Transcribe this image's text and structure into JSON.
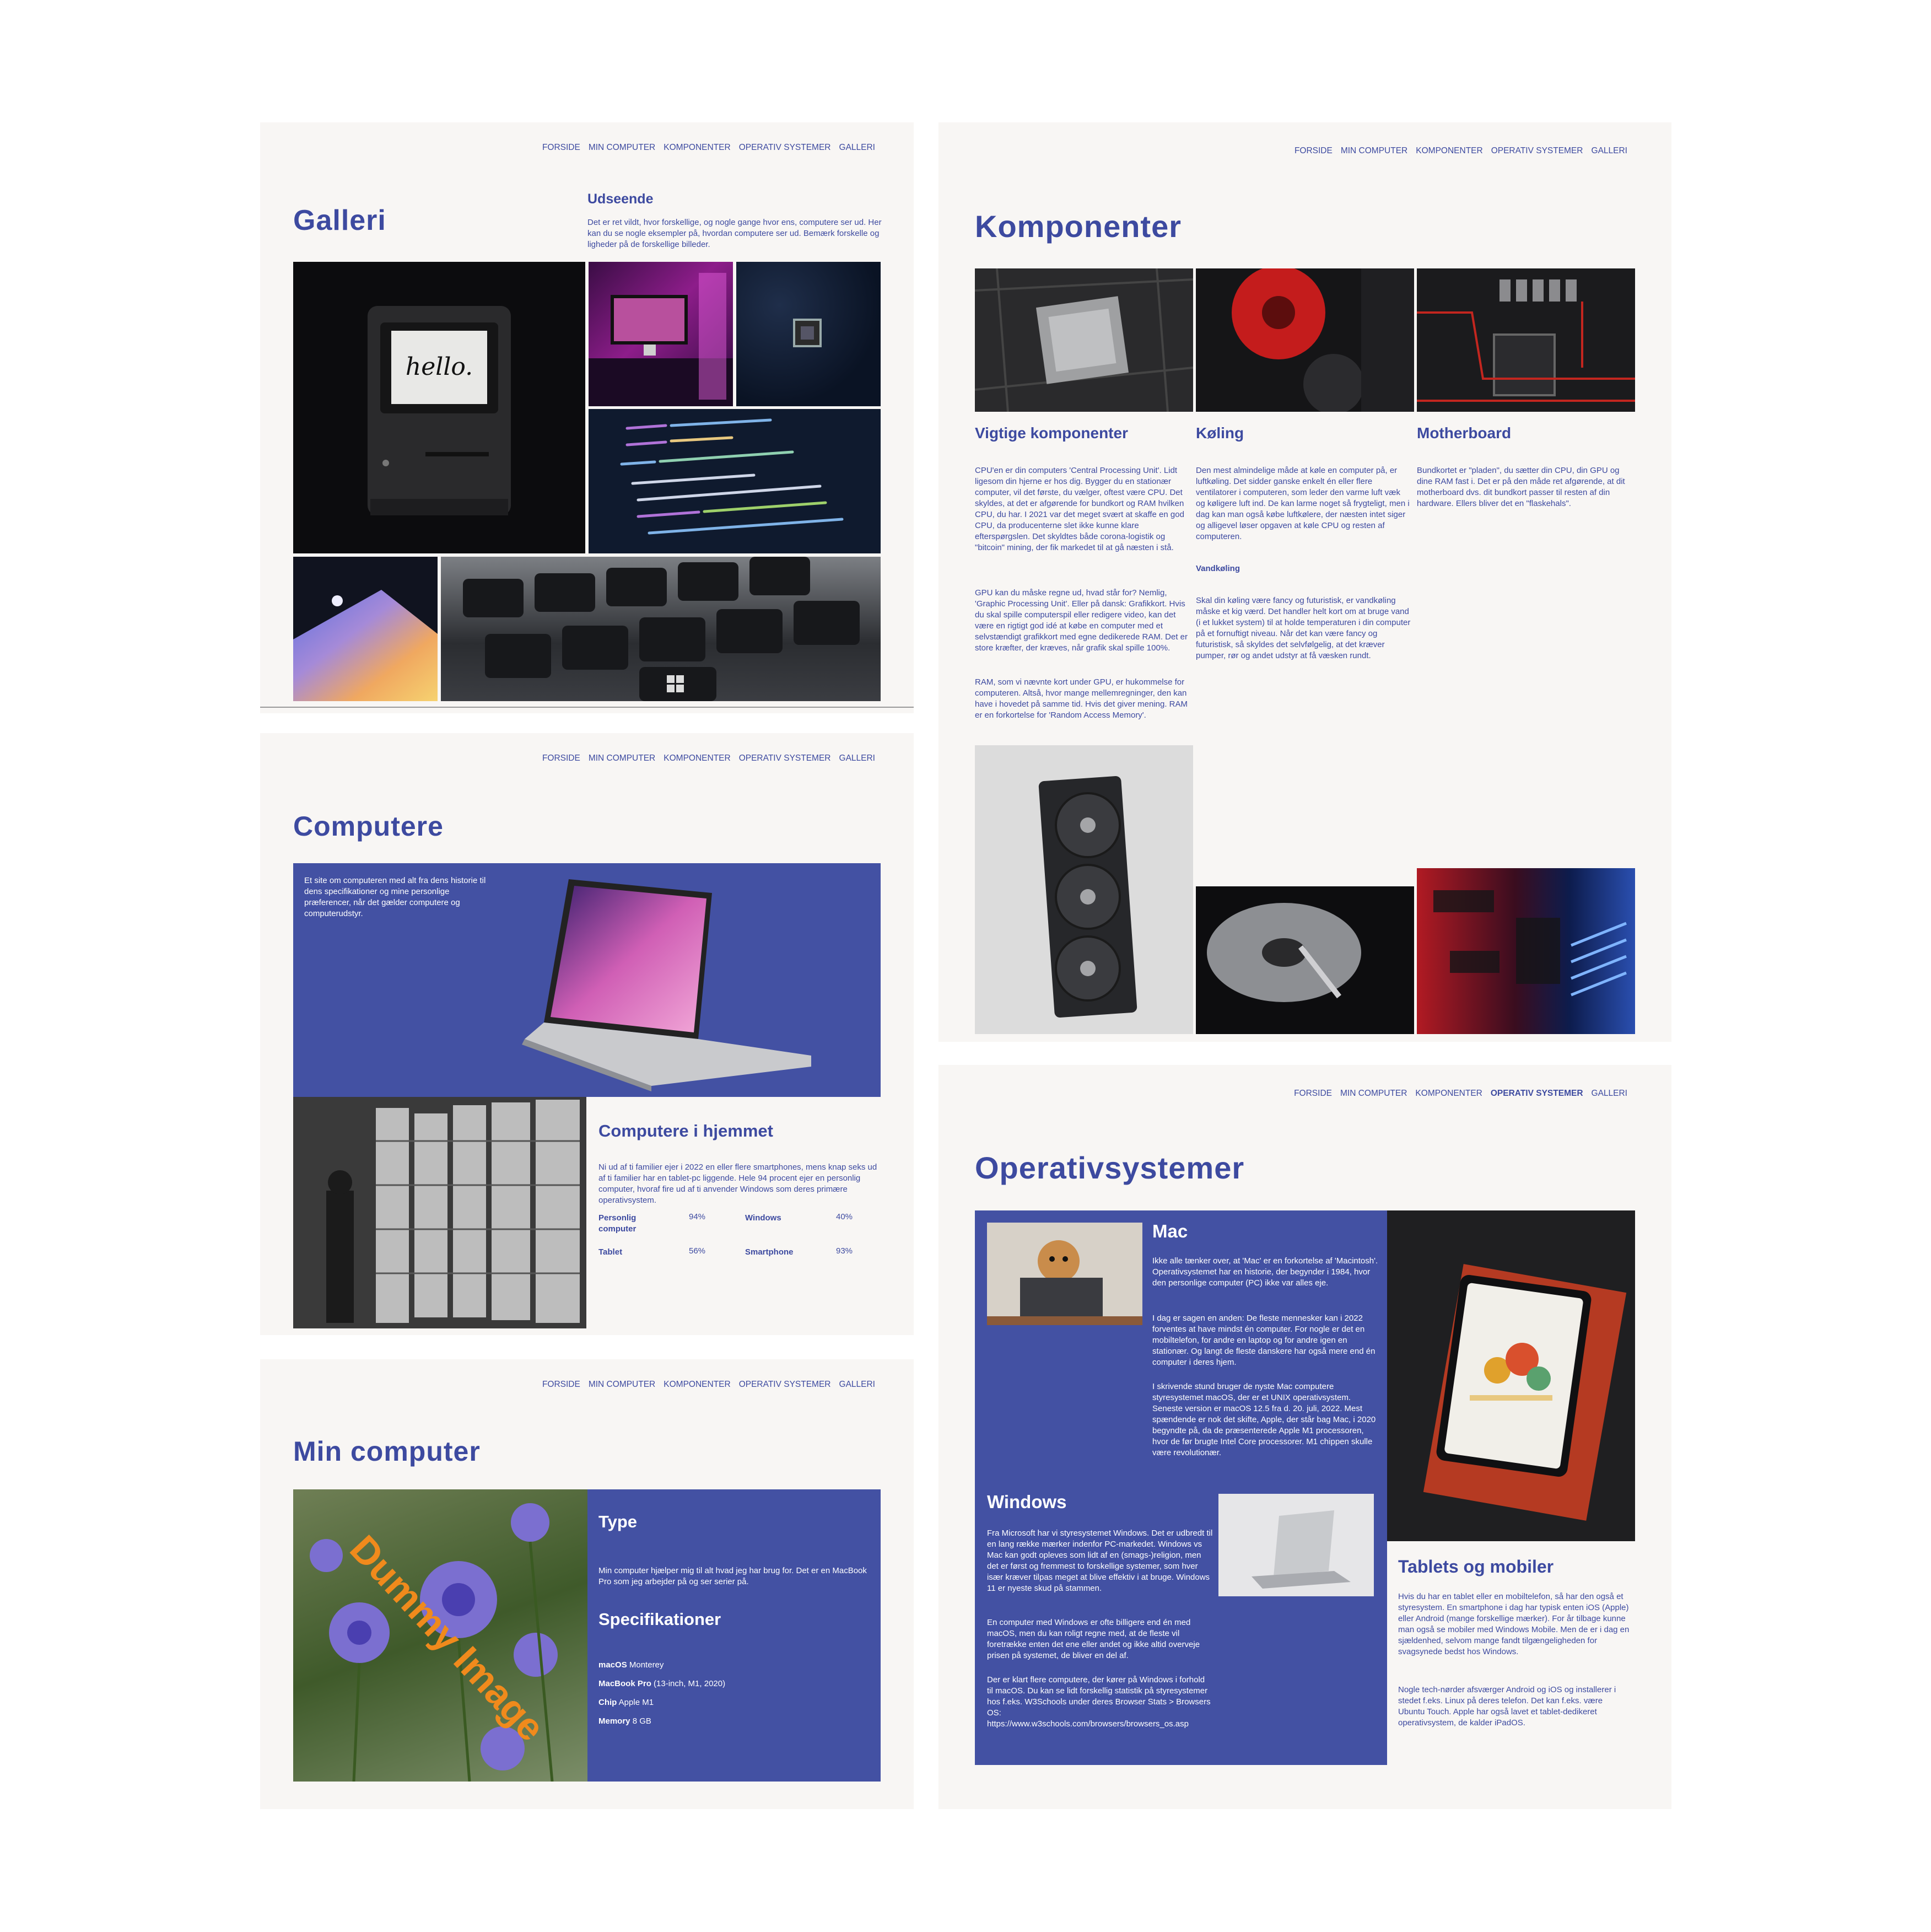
{
  "nav": [
    "FORSIDE",
    "MIN COMPUTER",
    "KOMPONENTER",
    "OPERATIV SYSTEMER",
    "GALLERI"
  ],
  "galleri": {
    "title": "Galleri",
    "heading": "Udseende",
    "text": "Det er ret vildt, hvor forskellige, og nogle gange hvor ens, computere ser ud. Her kan du se nogle eksempler på, hvordan computere ser ud. Bemærk forskelle og ligheder på de forskellige billeder.",
    "mac_screen_text": "hello."
  },
  "computere": {
    "title": "Computere",
    "hero_text": "Et site om computeren med alt fra dens historie til dens specifikationer og mine personlige præferencer, når det gælder computere og computerudstyr.",
    "heading": "Computere i hjemmet",
    "text": "Ni ud af ti familier ejer i 2022 en eller flere smartphones, mens knap seks ud af ti familier har en tablet-pc liggende. Hele 94 procent ejer en personlig computer, hvoraf fire ud af ti anvender Windows som deres primære operativsystem.",
    "stats": [
      {
        "label": "Personlig computer",
        "value": "94%"
      },
      {
        "label": "Windows",
        "value": "40%"
      },
      {
        "label": "Tablet",
        "value": "56%"
      },
      {
        "label": "Smartphone",
        "value": "93%"
      }
    ]
  },
  "min_computer": {
    "title": "Min computer",
    "watermark": "Dummy Image",
    "type_heading": "Type",
    "type_text": "Min computer hjælper mig til alt hvad jeg har brug for. Det er en MacBook Pro som jeg arbejder på og ser serier på.",
    "spec_heading": "Specifikationer",
    "specs": [
      {
        "label": "macOS",
        "value": "Monterey"
      },
      {
        "label": "MacBook Pro",
        "value": "(13-inch, M1, 2020)"
      },
      {
        "label": "Chip",
        "value": "Apple M1"
      },
      {
        "label": "Memory",
        "value": "8 GB"
      }
    ]
  },
  "komponenter": {
    "title": "Komponenter",
    "col1_heading": "Vigtige komponenter",
    "col1_p1": "CPU'en er din computers 'Central Processing Unit'. Lidt ligesom din hjerne er hos dig. Bygger du en stationær computer, vil det første, du vælger, oftest være CPU. Det skyldes, at det er afgørende for bundkort og RAM hvilken CPU, du har. I 2021 var det meget svært at skaffe en god CPU, da producenterne slet ikke kunne klare efterspørgslen. Det skyldtes både corona-logistik og \"bitcoin\" mining, der fik markedet til at gå næsten i stå.",
    "col1_p2": "GPU kan du måske regne ud, hvad står for? Nemlig, 'Graphic Processing Unit'. Eller på dansk: Grafikkort. Hvis du skal spille computerspil eller redigere video, kan det være en rigtigt god idé at købe en computer med et selvstændigt grafikkort med egne dedikerede RAM. Det er store kræfter, der kræves, når grafik skal spille 100%.",
    "col1_p3": "RAM, som vi nævnte kort under GPU, er hukommelse for computeren. Altså, hvor mange mellemregninger, den kan have i hovedet på samme tid. Hvis det giver mening. RAM er en forkortelse for 'Random Access Memory'.",
    "col2_heading": "Køling",
    "col2_p1": "Den mest almindelige måde at køle en computer på, er luftkøling. Det sidder ganske enkelt én eller flere ventilatorer i computeren, som leder den varme luft væk og køligere luft ind. De kan larme noget så frygteligt, men i dag kan man også købe luftkølere, der næsten intet siger og alligevel løser opgaven at køle CPU og resten af computeren.",
    "col2_sub": "Vandkøling",
    "col2_p2": "Skal din køling være fancy og futuristisk, er vandkøling måske et kig værd. Det handler helt kort om at bruge vand (i et lukket system) til at holde temperaturen i din computer på et fornuftigt niveau. Når det kan være fancy og futuristisk, så skyldes det selvfølgelig, at det kræver pumper, rør og andet udstyr at få væsken rundt.",
    "col3_heading": "Motherboard",
    "col3_p1": "Bundkortet er \"pladen\", du sætter din CPU, din GPU og dine RAM fast i. Det er på den måde ret afgørende, at dit motherboard dvs. dit bundkort passer til resten af din hardware. Ellers bliver det en \"flaskehals\"."
  },
  "os": {
    "title": "Operativsystemer",
    "mac_heading": "Mac",
    "mac_p1": "Ikke alle tænker over, at 'Mac' er en forkortelse af 'Macintosh'. Operativsystemet har en historie, der begynder i 1984, hvor den personlige computer (PC) ikke var alles eje.",
    "mac_p2": "I dag er sagen en anden: De fleste mennesker kan i 2022 forventes at have mindst én computer. For nogle er det en mobiltelefon, for andre en laptop og for andre igen en stationær. Og langt de fleste danskere har også mere end én computer i deres hjem.",
    "mac_p3": "I skrivende stund bruger de nyste Mac computere styresystemet macOS, der er et UNIX operativsystem. Seneste version er macOS 12.5 fra d. 20. juli, 2022. Mest spændende er nok det skifte, Apple, der står bag Mac, i 2020 begyndte på, da de præsenterede Apple M1 processoren, hvor de før brugte Intel Core processorer. M1 chippen skulle være revolutionær.",
    "win_heading": "Windows",
    "win_p1": "Fra Microsoft har vi styresystemet Windows. Det er udbredt til en lang række mærker indenfor PC-markedet. Windows vs Mac kan godt opleves som lidt af en (smags-)religion, men det er først og fremmest to forskellige systemer, som hver især kræver tilpas meget at blive effektiv i at bruge. Windows 11 er nyeste skud på stammen.",
    "win_p2": "En computer med Windows er ofte billigere end én med macOS, men du kan roligt regne med, at de fleste vil foretrække enten det ene eller andet og ikke altid overveje prisen på systemet, de bliver en del af.",
    "win_p3": "Der er klart flere computere, der kører på Windows i forhold til macOS. Du kan se lidt forskellig statistik på styresystemer hos f.eks. W3Schools under deres Browser Stats > Browsers OS:",
    "win_link": "https://www.w3schools.com/browsers/browsers_os.asp",
    "tab_heading": "Tablets og mobiler",
    "tab_p1": "Hvis du har en tablet eller en mobiltelefon, så har den også et styresystem. En smartphone i dag har typisk enten iOS (Apple) eller Android (mange forskellige mærker). For år tilbage kunne man også se mobiler med Windows Mobile. Men de er i dag en sjældenhed, selvom mange fandt tilgængeligheden for svagsynede bedst hos Windows.",
    "tab_p2": "Nogle tech-nørder afsværger Android og iOS og installerer i stedet f.eks. Linux på deres telefon. Det kan f.eks. være Ubuntu Touch. Apple har også lavet et tablet-dedikeret operativsystem, de kalder iPadOS."
  },
  "colors": {
    "accent": "#3d4aa0",
    "panel": "#4351a3",
    "page_bg": "#f8f6f4",
    "watermark": "#f08a1c"
  }
}
